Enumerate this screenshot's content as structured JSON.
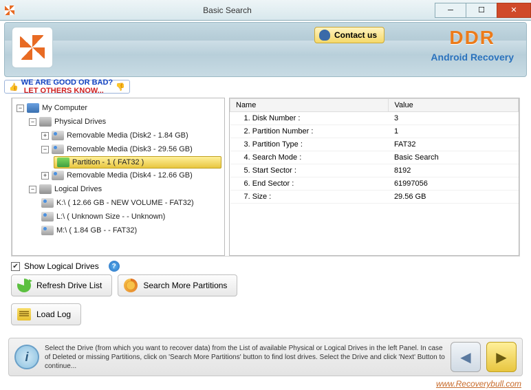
{
  "window": {
    "title": "Basic Search"
  },
  "brand": {
    "ddr": "DDR",
    "sub": "Android Recovery",
    "contact": "Contact us"
  },
  "promo": {
    "line1": "WE ARE GOOD OR BAD?",
    "line2": "LET OTHERS KNOW..."
  },
  "tree": {
    "root": "My Computer",
    "physical": "Physical Drives",
    "logical": "Logical Drives",
    "rm1": "Removable Media (Disk2 - 1.84 GB)",
    "rm2": "Removable Media (Disk3 - 29.56 GB)",
    "rm3": "Removable Media (Disk4 - 12.66 GB)",
    "part1": "Partition - 1 ( FAT32 )",
    "ld1": "K:\\ ( 12.66 GB - NEW VOLUME - FAT32)",
    "ld2": "L:\\ ( Unknown Size  -  - Unknown)",
    "ld3": "M:\\ ( 1.84 GB -  - FAT32)"
  },
  "details": {
    "headers": {
      "name": "Name",
      "value": "Value"
    },
    "rows": [
      {
        "name": "1. Disk Number :",
        "value": "3"
      },
      {
        "name": "2. Partition Number :",
        "value": "1"
      },
      {
        "name": "3. Partition Type :",
        "value": "FAT32"
      },
      {
        "name": "4. Search Mode :",
        "value": "Basic Search"
      },
      {
        "name": "5. Start Sector :",
        "value": "8192"
      },
      {
        "name": "6. End Sector :",
        "value": "61997056"
      },
      {
        "name": "7. Size :",
        "value": "29.56 GB"
      }
    ]
  },
  "controls": {
    "show_logical": "Show Logical Drives",
    "refresh": "Refresh Drive List",
    "search_more": "Search More Partitions",
    "load_log": "Load Log"
  },
  "hint": "Select the Drive (from which you want to recover data) from the List of available Physical or Logical Drives in the left Panel. In case of Deleted or missing Partitions, click on 'Search More Partitions' button to find lost drives. Select the Drive and click 'Next' Button to continue...",
  "watermark": "www.Recoverybull.com"
}
